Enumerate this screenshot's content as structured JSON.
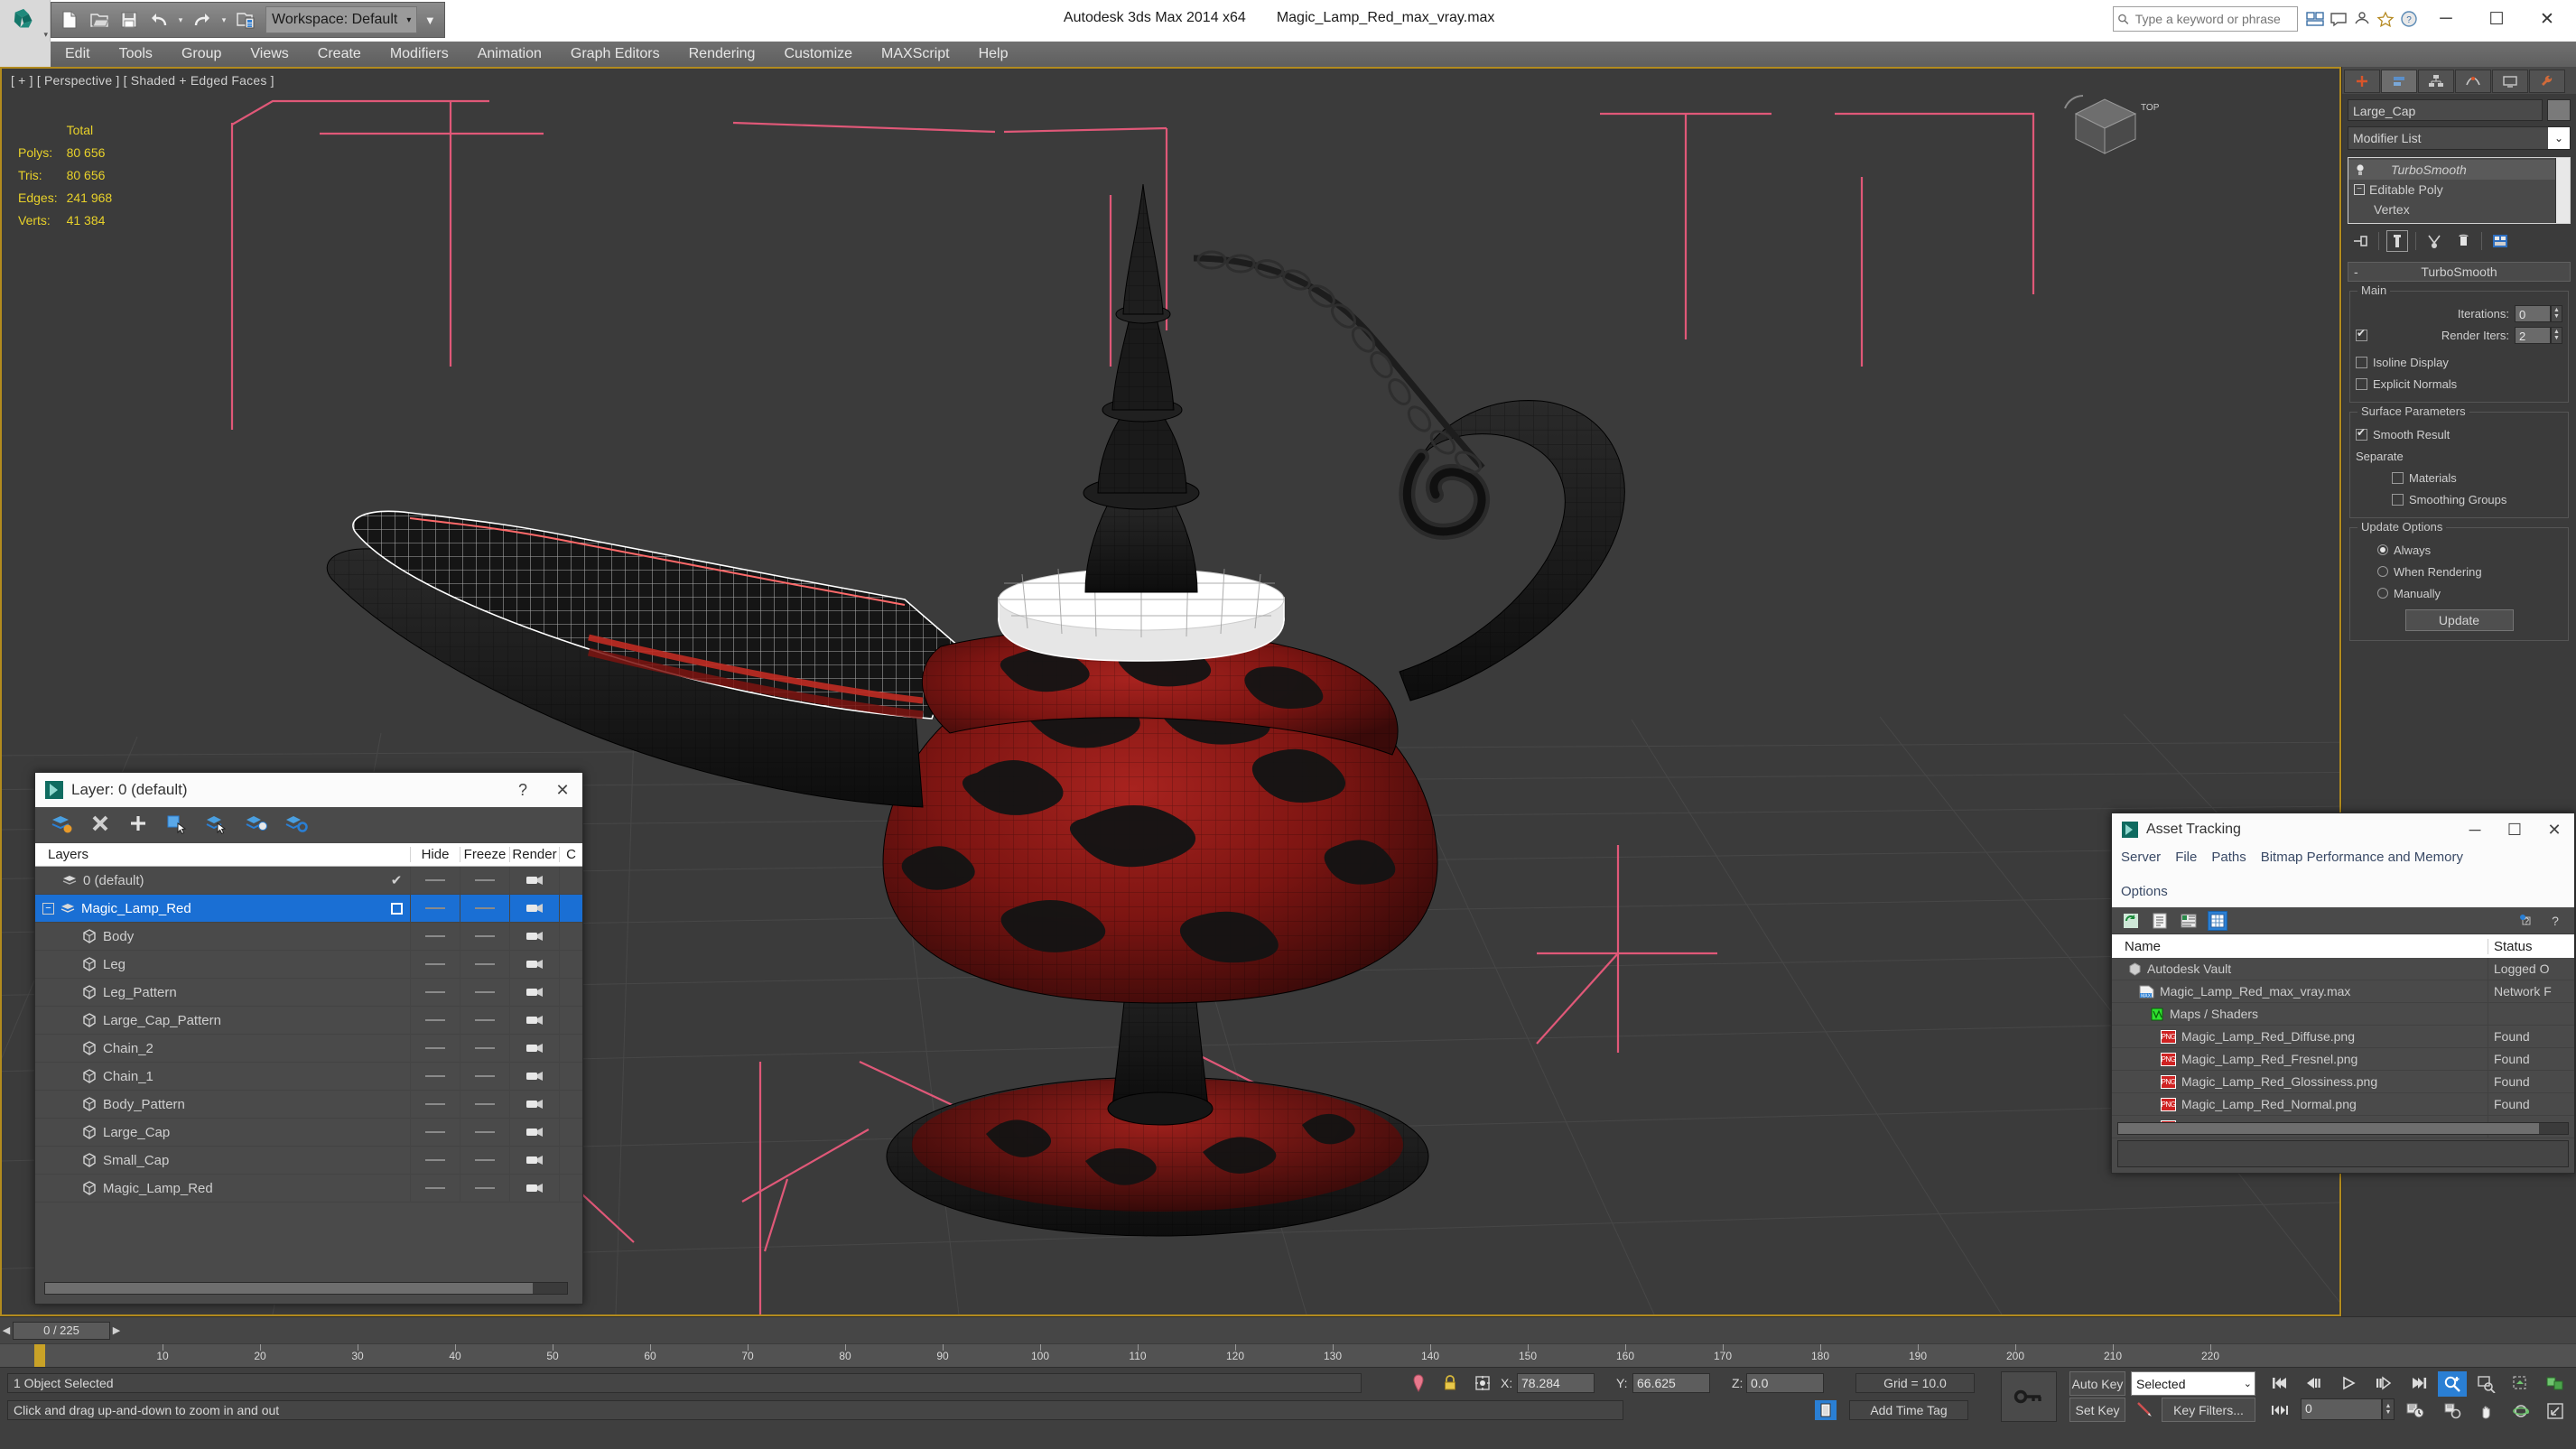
{
  "app": {
    "title": "Autodesk 3ds Max  2014 x64",
    "file": "Magic_Lamp_Red_max_vray.max",
    "logo": "3dsmax-logo-icon"
  },
  "quick_access": {
    "workspace_label": "Workspace: Default",
    "items": [
      {
        "name": "new-file-icon",
        "label": "New"
      },
      {
        "name": "open-file-icon",
        "label": "Open"
      },
      {
        "name": "save-file-icon",
        "label": "Save"
      },
      {
        "name": "undo-icon",
        "label": "Undo"
      },
      {
        "name": "redo-icon",
        "label": "Redo"
      },
      {
        "name": "set-project-folder-icon",
        "label": "Set Project Folder"
      }
    ]
  },
  "search": {
    "placeholder": "Type a keyword or phrase"
  },
  "title_right_icons": [
    "workspace-switch-icon",
    "communication-center-icon",
    "help-icon",
    "favorites-icon",
    "info-center-icon"
  ],
  "window_controls": {
    "minimize": "─",
    "maximize": "☐",
    "close": "✕"
  },
  "menu": {
    "items": [
      "Edit",
      "Tools",
      "Group",
      "Views",
      "Create",
      "Modifiers",
      "Animation",
      "Graph Editors",
      "Rendering",
      "Customize",
      "MAXScript",
      "Help"
    ]
  },
  "viewport": {
    "label": "[ + ] [ Perspective ] [ Shaded + Edged Faces ]",
    "stats": {
      "header": "Total",
      "rows": [
        {
          "label": "Polys:",
          "value": "80 656"
        },
        {
          "label": "Tris:",
          "value": "80 656"
        },
        {
          "label": "Edges:",
          "value": "241 968"
        },
        {
          "label": "Verts:",
          "value": "41 384"
        }
      ]
    },
    "viewcube_label": "TOP",
    "background": "#3b3b3b",
    "grid_color": "#4a4a4a",
    "gizmo_color": "#e05878",
    "object_red": "#8e1a1a",
    "object_dark": "#1c1c1c",
    "selection_white": "#ffffff"
  },
  "command_panel": {
    "tabs": [
      {
        "name": "create-tab",
        "icon": "plus-icon"
      },
      {
        "name": "modify-tab",
        "icon": "modify-icon"
      },
      {
        "name": "hierarchy-tab",
        "icon": "hierarchy-icon"
      },
      {
        "name": "motion-tab",
        "icon": "motion-icon"
      },
      {
        "name": "display-tab",
        "icon": "display-icon"
      },
      {
        "name": "utilities-tab",
        "icon": "utilities-icon"
      }
    ],
    "object_name": "Large_Cap",
    "modifier_list_label": "Modifier List",
    "modifier_stack": [
      {
        "label": "TurboSmooth",
        "selected": true,
        "italic": true
      },
      {
        "label": "Editable Poly",
        "selected": false,
        "italic": false
      },
      {
        "label": "Vertex",
        "selected": false,
        "italic": false,
        "sub": true
      }
    ],
    "stack_tools": [
      {
        "name": "pin-stack-icon"
      },
      {
        "name": "show-end-result-icon"
      },
      {
        "name": "make-unique-icon"
      },
      {
        "name": "remove-modifier-icon"
      },
      {
        "name": "configure-modifier-sets-icon"
      }
    ],
    "rollout": {
      "title": "TurboSmooth",
      "collapse_glyph": "-",
      "groups": [
        {
          "title": "Main",
          "rows": [
            {
              "type": "spinner",
              "label": "Iterations:",
              "value": "0"
            },
            {
              "type": "checkspinner",
              "label": "Render Iters:",
              "value": "2",
              "checked": true
            },
            {
              "type": "checkbox",
              "label": "Isoline Display",
              "checked": false
            },
            {
              "type": "checkbox",
              "label": "Explicit Normals",
              "checked": false
            }
          ]
        },
        {
          "title": "Surface Parameters",
          "rows": [
            {
              "type": "checkbox",
              "label": "Smooth Result",
              "checked": true
            },
            {
              "type": "text",
              "label": "Separate"
            },
            {
              "type": "checkbox-indent",
              "label": "Materials",
              "checked": false
            },
            {
              "type": "checkbox-indent",
              "label": "Smoothing Groups",
              "checked": false
            }
          ]
        },
        {
          "title": "Update Options",
          "rows": [
            {
              "type": "radio",
              "label": "Always",
              "checked": true
            },
            {
              "type": "radio",
              "label": "When Rendering",
              "checked": false
            },
            {
              "type": "radio",
              "label": "Manually",
              "checked": false
            },
            {
              "type": "button",
              "label": "Update"
            }
          ]
        }
      ]
    }
  },
  "layer_dialog": {
    "title": "Layer: 0 (default)",
    "help_glyph": "?",
    "close_glyph": "✕",
    "toolbar": [
      {
        "name": "create-new-layer-icon"
      },
      {
        "name": "delete-layer-icon"
      },
      {
        "name": "add-selection-to-layer-icon"
      },
      {
        "name": "select-objects-in-layer-icon"
      },
      {
        "name": "select-highlighted-objects-icon"
      },
      {
        "name": "highlight-selected-objects-icon"
      },
      {
        "name": "layer-properties-icon"
      }
    ],
    "columns": [
      "Layers",
      "",
      "Hide",
      "Freeze",
      "Render",
      "C"
    ],
    "rows": [
      {
        "name": "0 (default)",
        "indent": 0,
        "icon": "layer-icon",
        "current": true,
        "hide": "dash",
        "freeze": "dash",
        "render": "render-icon",
        "selected": false,
        "expander": ""
      },
      {
        "name": "Magic_Lamp_Red",
        "indent": 0,
        "icon": "layer-icon",
        "current": false,
        "hide": "box",
        "freeze": "dash",
        "render": "render-icon",
        "selected": true,
        "expander": "-"
      },
      {
        "name": "Body",
        "indent": 1,
        "icon": "object-icon",
        "hide": "dash",
        "freeze": "dash",
        "render": "render-icon",
        "selected": false
      },
      {
        "name": "Leg",
        "indent": 1,
        "icon": "object-icon",
        "hide": "dash",
        "freeze": "dash",
        "render": "render-icon",
        "selected": false
      },
      {
        "name": "Leg_Pattern",
        "indent": 1,
        "icon": "object-icon",
        "hide": "dash",
        "freeze": "dash",
        "render": "render-icon",
        "selected": false
      },
      {
        "name": "Large_Cap_Pattern",
        "indent": 1,
        "icon": "object-icon",
        "hide": "dash",
        "freeze": "dash",
        "render": "render-icon",
        "selected": false
      },
      {
        "name": "Chain_2",
        "indent": 1,
        "icon": "object-icon",
        "hide": "dash",
        "freeze": "dash",
        "render": "render-icon",
        "selected": false
      },
      {
        "name": "Chain_1",
        "indent": 1,
        "icon": "object-icon",
        "hide": "dash",
        "freeze": "dash",
        "render": "render-icon",
        "selected": false
      },
      {
        "name": "Body_Pattern",
        "indent": 1,
        "icon": "object-icon",
        "hide": "dash",
        "freeze": "dash",
        "render": "render-icon",
        "selected": false
      },
      {
        "name": "Large_Cap",
        "indent": 1,
        "icon": "object-icon",
        "hide": "dash",
        "freeze": "dash",
        "render": "render-icon",
        "selected": false
      },
      {
        "name": "Small_Cap",
        "indent": 1,
        "icon": "object-icon",
        "hide": "dash",
        "freeze": "dash",
        "render": "render-icon",
        "selected": false
      },
      {
        "name": "Magic_Lamp_Red",
        "indent": 1,
        "icon": "object-icon",
        "hide": "dash",
        "freeze": "dash",
        "render": "render-icon",
        "selected": false
      }
    ]
  },
  "asset_tracking": {
    "title": "Asset Tracking",
    "menu": [
      "Server",
      "File",
      "Paths",
      "Bitmap Performance and Memory",
      "Options"
    ],
    "toolbar": [
      {
        "name": "refresh-icon"
      },
      {
        "name": "list-view-icon"
      },
      {
        "name": "detail-view-icon"
      },
      {
        "name": "grid-view-icon",
        "active": true
      }
    ],
    "toolbar_right": [
      {
        "name": "help-dialog-icon"
      },
      {
        "name": "help-question-icon"
      }
    ],
    "columns": [
      "Name",
      "Status"
    ],
    "rows": [
      {
        "name": "Autodesk Vault",
        "indent": 0,
        "icon": "vault-icon",
        "status": "Logged O"
      },
      {
        "name": "Magic_Lamp_Red_max_vray.max",
        "indent": 1,
        "icon": "max-file-icon",
        "status": "Network F"
      },
      {
        "name": "Maps / Shaders",
        "indent": 2,
        "icon": "maps-shaders-icon",
        "status": ""
      },
      {
        "name": "Magic_Lamp_Red_Diffuse.png",
        "indent": 3,
        "icon": "png-icon",
        "status": "Found"
      },
      {
        "name": "Magic_Lamp_Red_Fresnel.png",
        "indent": 3,
        "icon": "png-icon",
        "status": "Found"
      },
      {
        "name": "Magic_Lamp_Red_Glossiness.png",
        "indent": 3,
        "icon": "png-icon",
        "status": "Found"
      },
      {
        "name": "Magic_Lamp_Red_Normal.png",
        "indent": 3,
        "icon": "png-icon",
        "status": "Found"
      },
      {
        "name": "Magic_Lamp_Red_Specular.png",
        "indent": 3,
        "icon": "png-icon",
        "status": "Found"
      }
    ]
  },
  "trackbar": {
    "frame_indicator": "0 / 225",
    "prev_glyph": "◀",
    "next_glyph": "▶"
  },
  "timeline": {
    "ticks": [
      "10",
      "20",
      "30",
      "40",
      "50",
      "60",
      "70",
      "80",
      "90",
      "100",
      "110",
      "120",
      "130",
      "140",
      "150",
      "160",
      "170",
      "180",
      "190",
      "200",
      "210",
      "220"
    ]
  },
  "status_bar": {
    "selection_text": "1 Object Selected",
    "prompt_text": "Click and drag up-and-down to zoom in and out",
    "coords": [
      {
        "label": "X:",
        "value": "78.284"
      },
      {
        "label": "Y:",
        "value": "66.625"
      },
      {
        "label": "Z:",
        "value": "0.0"
      }
    ],
    "grid_label": "Grid = 10.0",
    "add_time_tag": "Add Time Tag",
    "auto_key": "Auto Key",
    "set_key": "Set Key",
    "selection_set": "Selected",
    "key_filters": "Key Filters...",
    "current_frame": "0",
    "icons": {
      "pin": "isolate-selection-icon",
      "lock": "selection-lock-icon",
      "absolute": "absolute-relative-transform-icon",
      "key_mode": "key-mode-toggle-icon",
      "time_tag": "time-tag-icon"
    },
    "playback_icons": [
      "go-to-start-icon",
      "previous-frame-icon",
      "play-animation-icon",
      "next-frame-icon",
      "go-to-end-icon"
    ],
    "view_nav_icons": [
      "zoom-icon",
      "zoom-all-icon",
      "zoom-extents-icon",
      "zoom-extents-all-icon",
      "field-of-view-icon",
      "pan-view-icon",
      "orbit-icon",
      "maximize-viewport-toggle-icon"
    ],
    "key_mode_icon": "key-toggle-icon"
  }
}
